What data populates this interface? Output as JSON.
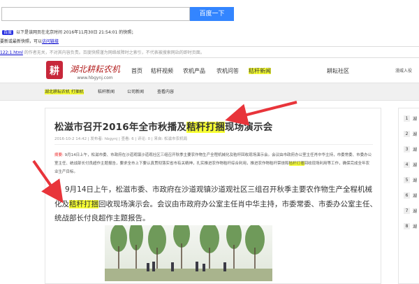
{
  "search": {
    "value": "",
    "button_label": "百度一下"
  },
  "snapshot": {
    "badge": "百度",
    "line1": "以下是该网页在北京时间 2016年11月30日 21:54:01 的快照；",
    "line2_prefix": "要新或最新快照，可以",
    "line2_link": "访问链接",
    "line3_url": "122:1.html",
    "line3_rest": " 的作者无关，不对其内容负责。百度快照谨为网络故障时之索引，不代表被搜索网站的即时页面。"
  },
  "site": {
    "logo_text": "湖北耕耘农机",
    "url": "www.hbgynj.com",
    "nav": [
      "首页",
      "秸秆视频",
      "农机产品",
      "农机问答",
      "秸秆新闻",
      "耕耘社区"
    ],
    "right_small": "漫威入役"
  },
  "subnav": [
    "湖北耕耘农机 打捆机",
    "秸秆新闻",
    "公司新闻",
    "查看内容"
  ],
  "article": {
    "title_pre": "松滋市召开2016年全市秋播及",
    "title_hl": "秸秆打捆",
    "title_post": "现场演示会",
    "meta": "2016-10-2 14:42  |  发布者: hbgynj  |  查看: 6  |  评论: 0  |  来自: 松滋市农机局",
    "summary_label": "摘要:",
    "summary": " 9月14日上午，松滋市委、市政府在沙道观镇沙道观社区三组召开秋季主要农作物生产全程机械化及秸秆回收现场演示会。会议由市政府办公室主任肖中华主持，市委常委、市委办公室主任、统战部长付良超作主题报告，要求全市上下要认真贯彻落实省市有关精神，扎实推进农作物秸秆综合利用，推进农作物秸秆禁烧和",
    "summary_hl": "秸秆打捆",
    "summary_tail": "回收现场利用等工作，确保完成全年农业生产目标。",
    "body_pre": "9月14日上午，松滋市委、市政府在沙道观镇沙道观社区三组召开秋季主要农作物生产全程机械化及",
    "body_hl": "秸秆打捆",
    "body_post": "回收现场演示会。会议由市政府办公室主任肖中华主持，市委常委、市委办公室主任、统战部长付良超作主题报告。"
  },
  "sidebar": {
    "items": [
      {
        "num": "1",
        "text": "湖"
      },
      {
        "num": "2",
        "text": "湖"
      },
      {
        "num": "3",
        "text": "湖"
      },
      {
        "num": "4",
        "text": "湖"
      },
      {
        "num": "5",
        "text": "湖"
      },
      {
        "num": "6",
        "text": "湖"
      },
      {
        "num": "7",
        "text": "湖"
      },
      {
        "num": "8",
        "text": "湖"
      }
    ]
  },
  "colors": {
    "highlight": "#f7ff33",
    "arrow": "#e8343a",
    "search_button": "#3385ff"
  }
}
